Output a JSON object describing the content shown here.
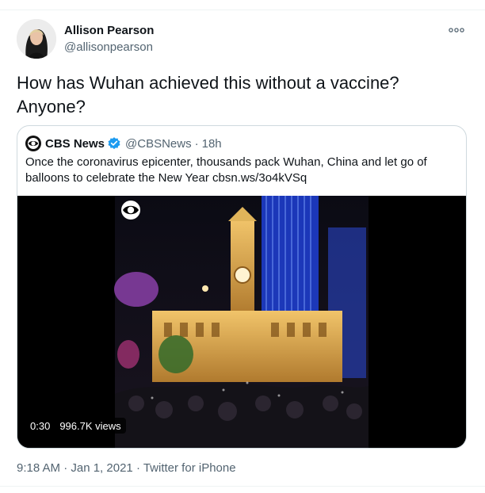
{
  "tweet": {
    "author_name": "Allison Pearson",
    "author_handle": "@allisonpearson",
    "text": "How has Wuhan achieved this without a vaccine? Anyone?",
    "timestamp": "9:18 AM · Jan 1, 2021",
    "separator": "·",
    "source": "Twitter for iPhone"
  },
  "quote": {
    "author_name": "CBS News",
    "author_handle": "@CBSNews",
    "separator": "·",
    "time": "18h",
    "text": "Once the coronavirus epicenter, thousands pack Wuhan, China and let go of balloons to celebrate the New Year cbsn.ws/3o4kVSq",
    "video": {
      "duration": "0:30",
      "views": "996.7K views"
    }
  },
  "icons": {
    "more": "more-options-icon",
    "verified": "verified-badge-icon",
    "cbs": "cbs-eye-logo"
  },
  "colors": {
    "text": "#0f1419",
    "secondary": "#536471",
    "verified": "#1d9bf0",
    "border": "#cfd9de"
  }
}
